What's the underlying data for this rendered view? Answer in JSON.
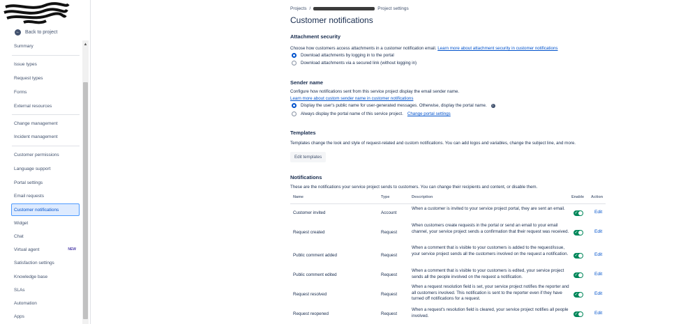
{
  "sidebar": {
    "back_label": "Back to project",
    "items": [
      {
        "label": "Summary"
      },
      {
        "label": "Issue types"
      },
      {
        "label": "Request types"
      },
      {
        "label": "Forms"
      },
      {
        "label": "External resources"
      },
      {
        "label": "Change management"
      },
      {
        "label": "Incident management"
      },
      {
        "label": "Customer permissions"
      },
      {
        "label": "Language support"
      },
      {
        "label": "Portal settings"
      },
      {
        "label": "Email requests"
      },
      {
        "label": "Customer notifications"
      },
      {
        "label": "Widget"
      },
      {
        "label": "Chat"
      },
      {
        "label": "Virtual agent",
        "badge": "NEW"
      },
      {
        "label": "Satisfaction settings"
      },
      {
        "label": "Knowledge base"
      },
      {
        "label": "SLAs"
      },
      {
        "label": "Automation"
      },
      {
        "label": "Apps"
      }
    ]
  },
  "breadcrumb": {
    "projects": "Projects",
    "sep": "/",
    "settings": "Project settings"
  },
  "page_title": "Customer notifications",
  "attachment": {
    "title": "Attachment security",
    "desc": "Choose how customers access attachments in a customer notification email.",
    "link": "Learn more about attachment security in customer notifications",
    "options": [
      "Download attachments by logging in to the portal",
      "Download attachments via a secured link (without logging in)"
    ]
  },
  "sender": {
    "title": "Sender name",
    "desc": "Configure how notifications sent from this service project display the email sender name.",
    "link": "Learn more about custom sender name in customer notifications",
    "option1": "Display the user's public name for user-generated messages. Otherwise, display the portal name.",
    "option2": "Always display the portal name of this service project.",
    "option2_link": "Change portal settings"
  },
  "templates": {
    "title": "Templates",
    "desc": "Templates change the look and style of request-related and custom notifications. You can add logos and variables, change the subject line, and more.",
    "button": "Edit templates"
  },
  "notifications": {
    "title": "Notifications",
    "desc": "These are the notifications your service project sends to customers. You can change their recipients and content, or disable them.",
    "headers": {
      "name": "Name",
      "type": "Type",
      "description": "Description",
      "enable": "Enable",
      "action": "Action"
    },
    "rows": [
      {
        "name": "Customer invited",
        "type": "Account",
        "description": "When a customer is invited to your service project portal, they are sent an email.",
        "enabled": true,
        "action": "Edit"
      },
      {
        "name": "Request created",
        "type": "Request",
        "description": "When customers create requests in the portal or send an email to your email channel, your service project sends a confirmation that their request was received.",
        "enabled": true,
        "action": "Edit"
      },
      {
        "name": "Public comment added",
        "type": "Request",
        "description": "When a comment that is visible to your customers is added to the request/issue, your service project sends all the customers involved on the request a notification.",
        "enabled": true,
        "action": "Edit"
      },
      {
        "name": "Public comment edited",
        "type": "Request",
        "description": "When a comment that is visible to your customers is edited, your service project sends all the people involved on the request a notification.",
        "enabled": true,
        "action": "Edit"
      },
      {
        "name": "Request resolved",
        "type": "Request",
        "description": "When a request resolution field is set, your service project notifies the reporter and all customers involved. This notification is sent to the reporter even if they have turned off notifications for a request.",
        "enabled": true,
        "action": "Edit"
      },
      {
        "name": "Request reopened",
        "type": "Request",
        "description": "When a request's resolution field is cleared, your service project notifies all people involved.",
        "enabled": true,
        "action": "Edit"
      }
    ]
  },
  "colors": {
    "link": "#0052cc",
    "toggle_on": "#00875a",
    "active_nav_bg": "#deebff"
  }
}
